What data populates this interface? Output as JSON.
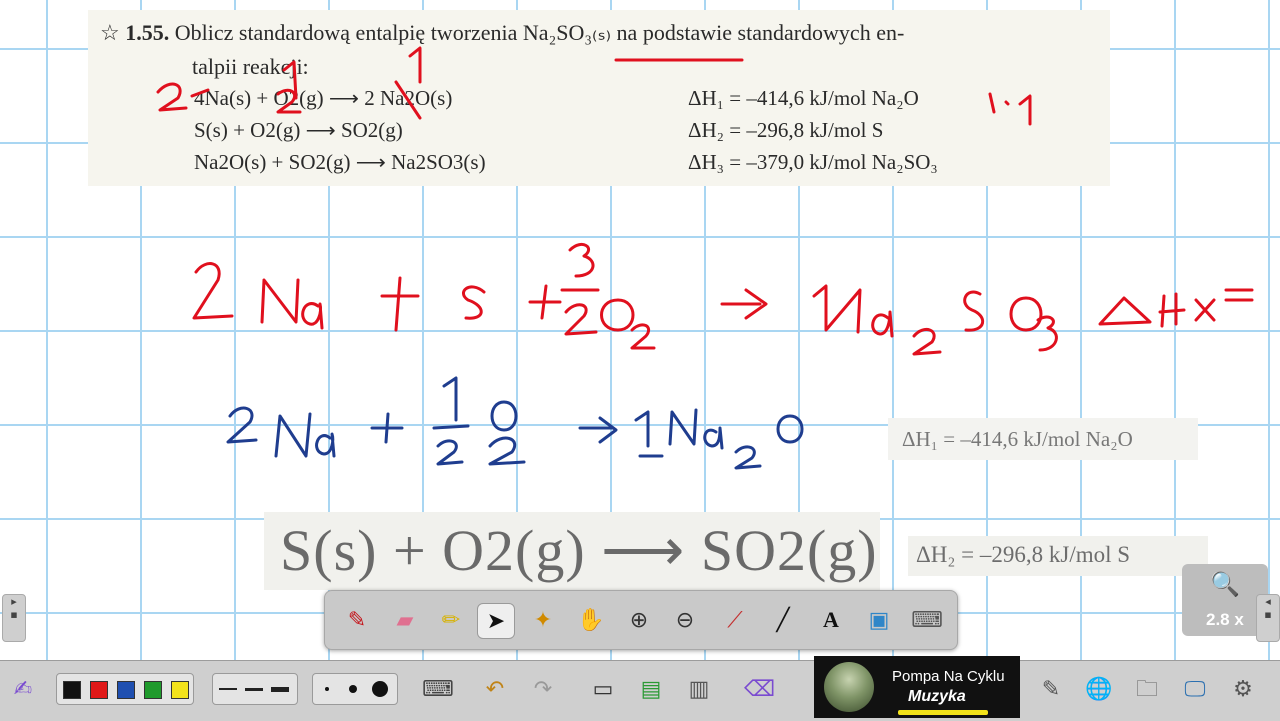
{
  "problem": {
    "number": "1.55.",
    "prompt": "Oblicz standardową entalpię tworzenia Na₂SO₃₍ₛ₎ na podstawie standardowych en-",
    "prompt_cont": "talpii reakcji:",
    "reactions": [
      {
        "equation": "4Na(s) + O2(g) ⟶ 2 Na2O(s)",
        "dh": "ΔH₁ = –414,6 kJ/mol Na₂O"
      },
      {
        "equation": "S(s) + O2(g) ⟶ SO2(g)",
        "dh": "ΔH₂ = –296,8 kJ/mol S"
      },
      {
        "equation": "Na2O(s) + SO2(g) ⟶ Na2SO3(s)",
        "dh": "ΔH₃ = –379,0 kJ/mol Na₂SO₃"
      }
    ]
  },
  "pasted": {
    "dh1": "ΔH₁ = –414,6 kJ/mol Na₂O",
    "reaction2_large": "S(s) + O2(g) ⟶ SO2(g)",
    "dh2": "ΔH₂ = –296,8 kJ/mol S"
  },
  "handwriting": {
    "line1": "2 Na + S + 3/2 O2 -> 1Na2SO3 ΔHx =",
    "line2": "2 Na + 1/2 O2 -> 1Na2O",
    "annotations": [
      "2",
      "1",
      "2",
      "1",
      "1 · 1"
    ],
    "colors": {
      "red": "#e0101e",
      "blue": "#1f3d8f"
    }
  },
  "toolbar": {
    "tools": [
      "pen",
      "eraser",
      "highlighter",
      "select",
      "magic-wand",
      "hand-pan",
      "zoom-in",
      "zoom-out",
      "laser-pointer",
      "line",
      "text",
      "screen-capture",
      "keyboard"
    ],
    "active": "select"
  },
  "zoom": {
    "level": "2.8 x"
  },
  "taskbar": {
    "colors": [
      "#111111",
      "#e01818",
      "#1f4fb0",
      "#1f9a2c",
      "#f3e21a"
    ],
    "now_playing": {
      "title": "Pompa Na Cyklu",
      "subtitle": "Muzyka"
    }
  }
}
